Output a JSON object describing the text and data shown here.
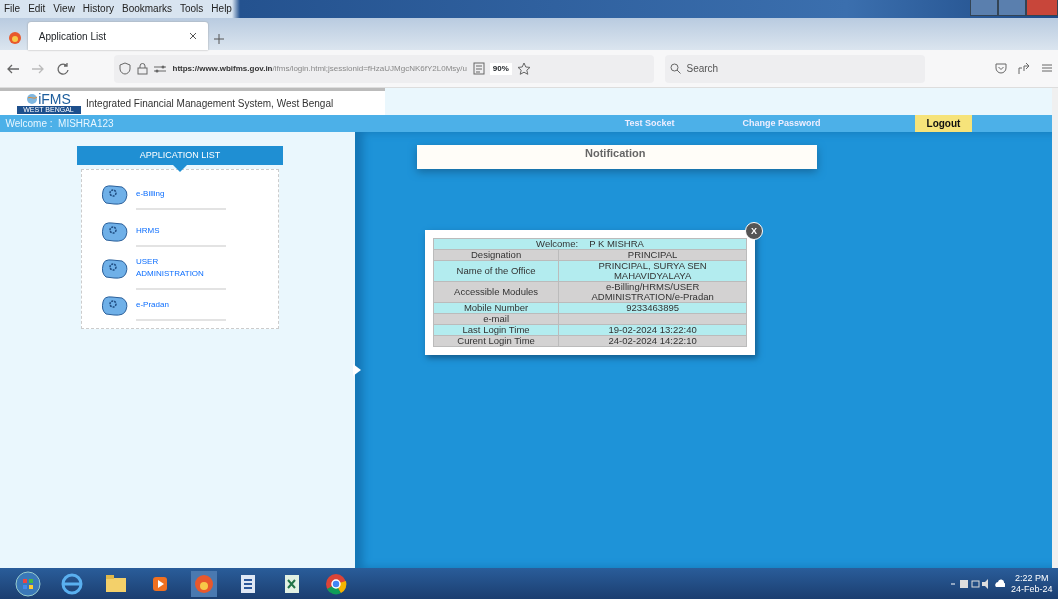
{
  "menu_bar": [
    "File",
    "Edit",
    "View",
    "History",
    "Bookmarks",
    "Tools",
    "Help"
  ],
  "tabs": [
    {
      "label": "Application List",
      "selected": true
    }
  ],
  "address_bar": {
    "url_host": "https://www.wbifms.gov.in",
    "url_path": "/ifms/login.html;jsessionid=fHzaUJMgcNK6fY2L0Msy/u",
    "zoom": "90%"
  },
  "search": {
    "placeholder": "Search"
  },
  "site_header": {
    "logo": "iFMS",
    "logo_subtitle": "WEST BENGAL",
    "title": "Integrated Financial Management System, West Bengal"
  },
  "top_bar": {
    "welcome_label": "Welcome :",
    "user": "MISHRA123",
    "links": [
      "Test Socket",
      "Change Password"
    ],
    "logout": "Logout"
  },
  "application_list": {
    "title": "APPLICATION LIST",
    "items": [
      "e-Billing",
      "HRMS",
      "USER ADMINISTRATION",
      "e-Pradan"
    ]
  },
  "notification": {
    "title": "Notification"
  },
  "popup": {
    "close": "X",
    "welcome_label": "Welcome:",
    "name": "P K MISHRA",
    "rows": [
      {
        "label": "Designation",
        "value": "PRINCIPAL"
      },
      {
        "label": "Name of the Office",
        "value": "PRINCIPAL, SURYA SEN MAHAVIDYALAYA"
      },
      {
        "label": "Accessible Modules",
        "value": "e-Billing/HRMS/USER ADMINISTRATION/e-Pradan"
      },
      {
        "label": "Mobile Number",
        "value": "9233463895"
      },
      {
        "label": "e-mail"
      },
      {
        "label": "Last Login Time",
        "value": "19-02-2024 13:22:40"
      },
      {
        "label": "Curent Login Time",
        "value": "24-02-2024 14:22:10"
      }
    ]
  },
  "taskbar": {
    "time": "2:22 PM",
    "date": "24-Feb-24"
  }
}
